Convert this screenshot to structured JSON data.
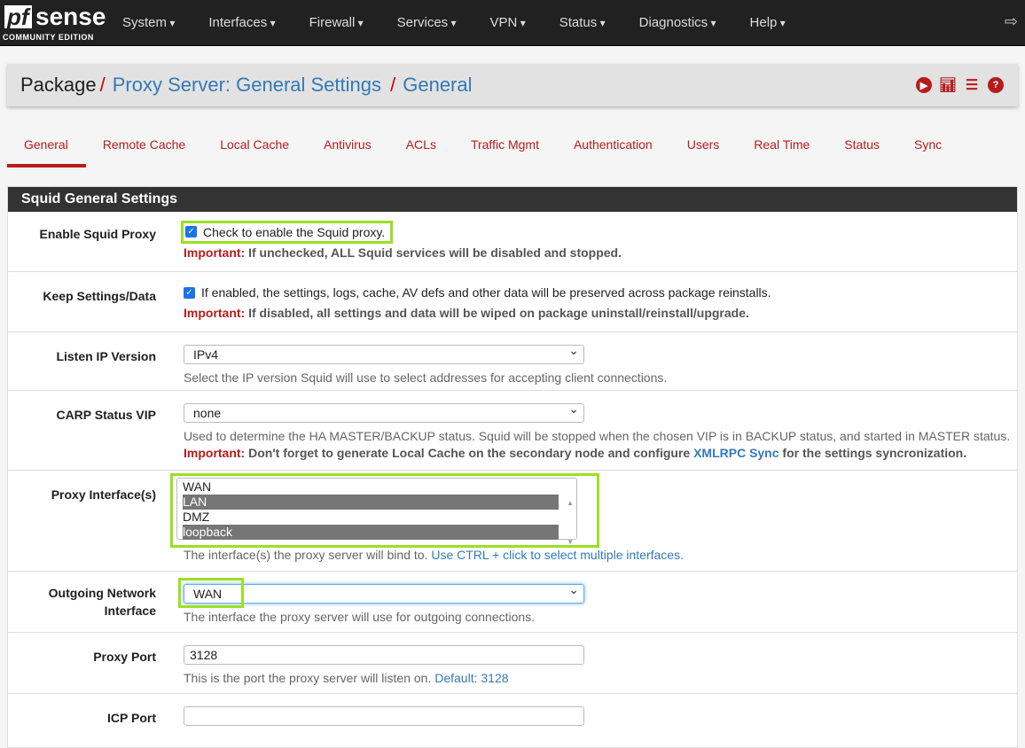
{
  "nav": {
    "logo_main": "pfsense",
    "logo_sub": "COMMUNITY EDITION",
    "menu": [
      "System",
      "Interfaces",
      "Firewall",
      "Services",
      "VPN",
      "Status",
      "Diagnostics",
      "Help"
    ]
  },
  "breadcrumb": {
    "root": "Package",
    "section": "Proxy Server: General Settings",
    "page": "General"
  },
  "tabs": [
    "General",
    "Remote Cache",
    "Local Cache",
    "Antivirus",
    "ACLs",
    "Traffic Mgmt",
    "Authentication",
    "Users",
    "Real Time",
    "Status",
    "Sync"
  ],
  "panel_title": "Squid General Settings",
  "rows": {
    "enable": {
      "label": "Enable Squid Proxy",
      "checkbox": "Check to enable the Squid proxy.",
      "checked": true,
      "imp": "Important:",
      "note": "If unchecked, ALL Squid services will be disabled and stopped."
    },
    "keep": {
      "label": "Keep Settings/Data",
      "checkbox": "If enabled, the settings, logs, cache, AV defs and other data will be preserved across package reinstalls.",
      "checked": true,
      "imp": "Important:",
      "note": "If disabled, all settings and data will be wiped on package uninstall/reinstall/upgrade."
    },
    "ipver": {
      "label": "Listen IP Version",
      "value": "IPv4",
      "help": "Select the IP version Squid will use to select addresses for accepting client connections."
    },
    "carp": {
      "label": "CARP Status VIP",
      "value": "none",
      "help": "Used to determine the HA MASTER/BACKUP status. Squid will be stopped when the chosen VIP is in BACKUP status, and started in MASTER status.",
      "imp": "Important:",
      "note": "Don't forget to generate Local Cache on the secondary node and configure",
      "link": "XMLRPC Sync",
      "note2": "for the settings syncronization."
    },
    "iface": {
      "label": "Proxy Interface(s)",
      "options": [
        "WAN",
        "LAN",
        "DMZ",
        "loopback"
      ],
      "selected": [
        "LAN",
        "loopback"
      ],
      "help": "The interface(s) the proxy server will bind to.",
      "help_blue": "Use CTRL + click to select multiple interfaces."
    },
    "outgoing": {
      "label1": "Outgoing Network",
      "label2": "Interface",
      "value": "WAN",
      "help": "The interface the proxy server will use for outgoing connections."
    },
    "port": {
      "label": "Proxy Port",
      "value": "3128",
      "help": "This is the port the proxy server will listen on.",
      "help_blue": "Default: 3128"
    },
    "icp": {
      "label": "ICP Port",
      "value": ""
    }
  },
  "colors": {
    "accent": "#b71c1c",
    "link": "#337ab7",
    "highlight": "#9be022"
  }
}
